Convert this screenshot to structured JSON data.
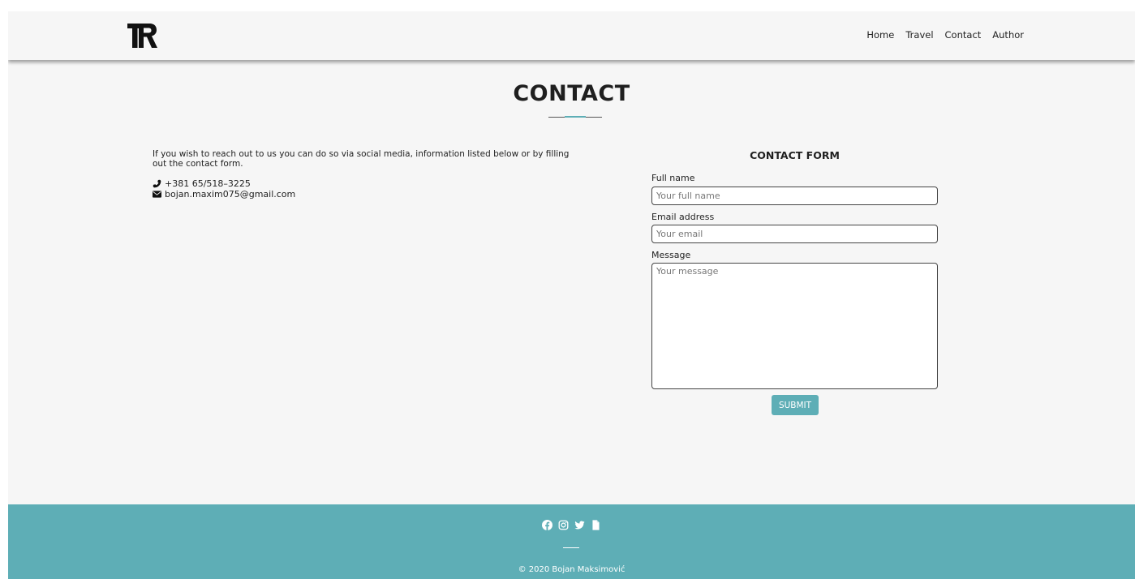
{
  "header": {
    "logo_text": "TR",
    "nav": [
      {
        "label": "Home"
      },
      {
        "label": "Travel"
      },
      {
        "label": "Contact"
      },
      {
        "label": "Author"
      }
    ]
  },
  "main": {
    "title": "CONTACT",
    "intro": "If you wish to reach out to us you can do so via social media, information listed below or by filling out the contact form.",
    "phone": "+381 65/518–3225",
    "email": "bojan.maxim075@gmail.com"
  },
  "form": {
    "title": "CONTACT FORM",
    "full_name_label": "Full name",
    "full_name_placeholder": "Your full name",
    "full_name_value": "",
    "email_label": "Email address",
    "email_placeholder": "Your email",
    "email_value": "",
    "message_label": "Message",
    "message_placeholder": "Your message",
    "message_value": "",
    "submit_label": "SUBMIT"
  },
  "footer": {
    "social_icons": [
      "facebook-icon",
      "instagram-icon",
      "twitter-icon",
      "document-icon"
    ],
    "copyright": "© 2020 Bojan Maksimović"
  },
  "colors": {
    "accent": "#5eaeb6",
    "background": "#f6f6f6",
    "text": "#222222"
  }
}
